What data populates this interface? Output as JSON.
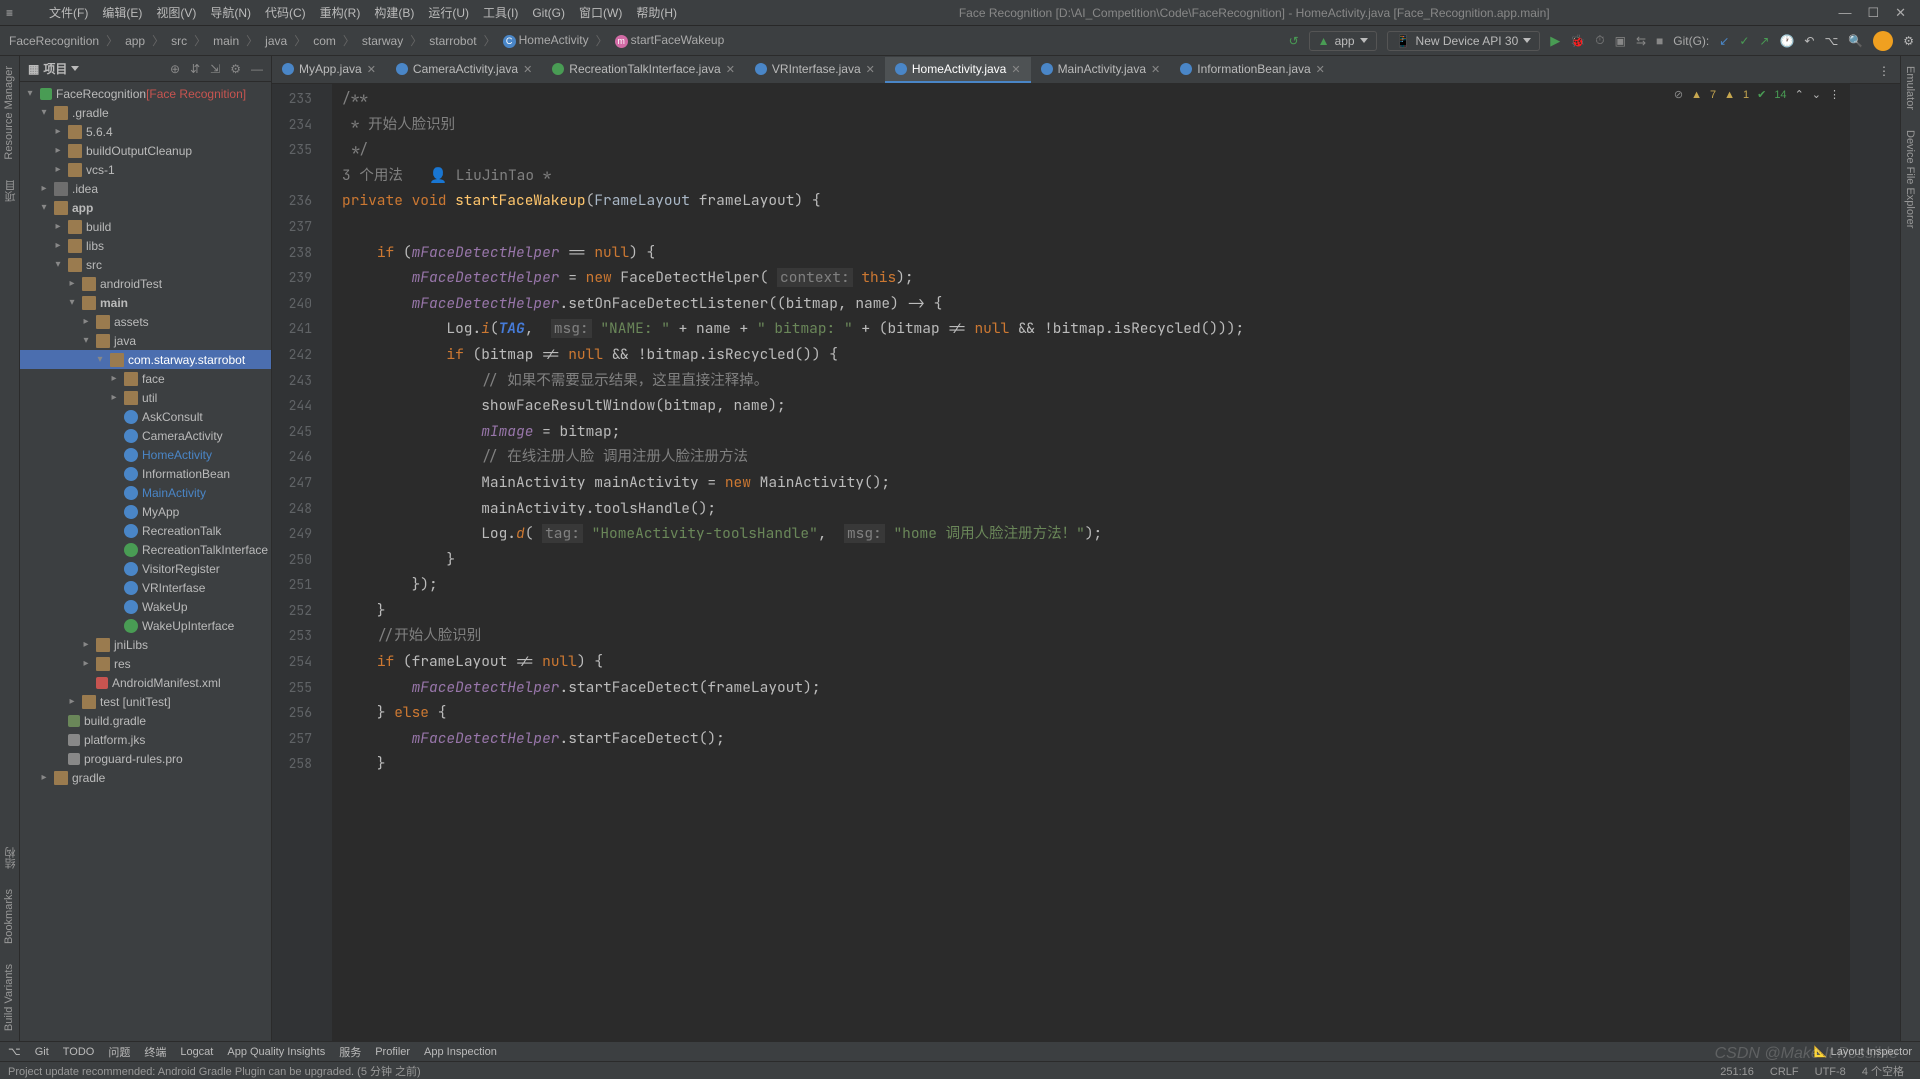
{
  "title": "Face Recognition [D:\\AI_Competition\\Code\\FaceRecognition] - HomeActivity.java [Face_Recognition.app.main]",
  "menus": [
    "文件(F)",
    "编辑(E)",
    "视图(V)",
    "导航(N)",
    "代码(C)",
    "重构(R)",
    "构建(B)",
    "运行(U)",
    "工具(I)",
    "Git(G)",
    "窗口(W)",
    "帮助(H)"
  ],
  "breadcrumb": [
    "FaceRecognition",
    "app",
    "src",
    "main",
    "java",
    "com",
    "starway",
    "starrobot"
  ],
  "breadcrumb_class": "HomeActivity",
  "breadcrumb_method": "startFaceWakeup",
  "run_config": "app",
  "device": "New Device API 30",
  "git_label": "Git(G):",
  "project_label": "项目",
  "tree": [
    {
      "d": 0,
      "a": "open",
      "i": "project",
      "t": "FaceRecognition",
      "suffix": " [Face Recognition]"
    },
    {
      "d": 1,
      "a": "open",
      "i": "folder",
      "t": ".gradle"
    },
    {
      "d": 2,
      "a": "closed",
      "i": "folder",
      "t": "5.6.4"
    },
    {
      "d": 2,
      "a": "closed",
      "i": "folder",
      "t": "buildOutputCleanup"
    },
    {
      "d": 2,
      "a": "closed",
      "i": "folder",
      "t": "vcs-1"
    },
    {
      "d": 1,
      "a": "closed",
      "i": "folder-dark",
      "t": ".idea"
    },
    {
      "d": 1,
      "a": "open",
      "i": "folder",
      "t": "app",
      "hl": true
    },
    {
      "d": 2,
      "a": "closed",
      "i": "folder",
      "t": "build"
    },
    {
      "d": 2,
      "a": "closed",
      "i": "folder",
      "t": "libs"
    },
    {
      "d": 2,
      "a": "open",
      "i": "folder",
      "t": "src"
    },
    {
      "d": 3,
      "a": "closed",
      "i": "folder",
      "t": "androidTest"
    },
    {
      "d": 3,
      "a": "open",
      "i": "folder",
      "t": "main",
      "hl": true
    },
    {
      "d": 4,
      "a": "closed",
      "i": "folder",
      "t": "assets"
    },
    {
      "d": 4,
      "a": "open",
      "i": "folder",
      "t": "java"
    },
    {
      "d": 5,
      "a": "open",
      "i": "folder",
      "t": "com.starway.starrobot",
      "sel": true
    },
    {
      "d": 6,
      "a": "closed",
      "i": "folder",
      "t": "face"
    },
    {
      "d": 6,
      "a": "closed",
      "i": "folder",
      "t": "util"
    },
    {
      "d": 6,
      "a": "none",
      "i": "class",
      "t": "AskConsult"
    },
    {
      "d": 6,
      "a": "none",
      "i": "class",
      "t": "CameraActivity"
    },
    {
      "d": 6,
      "a": "none",
      "i": "class",
      "t": "HomeActivity",
      "active": true
    },
    {
      "d": 6,
      "a": "none",
      "i": "class",
      "t": "InformationBean"
    },
    {
      "d": 6,
      "a": "none",
      "i": "class",
      "t": "MainActivity",
      "active": true
    },
    {
      "d": 6,
      "a": "none",
      "i": "class",
      "t": "MyApp"
    },
    {
      "d": 6,
      "a": "none",
      "i": "class",
      "t": "RecreationTalk"
    },
    {
      "d": 6,
      "a": "none",
      "i": "class-i",
      "t": "RecreationTalkInterface"
    },
    {
      "d": 6,
      "a": "none",
      "i": "class",
      "t": "VisitorRegister"
    },
    {
      "d": 6,
      "a": "none",
      "i": "class",
      "t": "VRInterfase"
    },
    {
      "d": 6,
      "a": "none",
      "i": "class",
      "t": "WakeUp"
    },
    {
      "d": 6,
      "a": "none",
      "i": "class-i",
      "t": "WakeUpInterface"
    },
    {
      "d": 4,
      "a": "closed",
      "i": "folder",
      "t": "jniLibs"
    },
    {
      "d": 4,
      "a": "closed",
      "i": "folder",
      "t": "res"
    },
    {
      "d": 4,
      "a": "none",
      "i": "xml",
      "t": "AndroidManifest.xml"
    },
    {
      "d": 3,
      "a": "closed",
      "i": "folder",
      "t": "test [unitTest]"
    },
    {
      "d": 2,
      "a": "none",
      "i": "gradle",
      "t": "build.gradle"
    },
    {
      "d": 2,
      "a": "none",
      "i": "jks",
      "t": "platform.jks"
    },
    {
      "d": 2,
      "a": "none",
      "i": "jks",
      "t": "proguard-rules.pro"
    },
    {
      "d": 1,
      "a": "closed",
      "i": "folder",
      "t": "gradle"
    }
  ],
  "tabs": [
    {
      "icon": "class",
      "label": "MyApp.java"
    },
    {
      "icon": "class",
      "label": "CameraActivity.java"
    },
    {
      "icon": "class-i",
      "label": "RecreationTalkInterface.java"
    },
    {
      "icon": "class",
      "label": "VRInterfase.java"
    },
    {
      "icon": "class",
      "label": "HomeActivity.java",
      "active": true
    },
    {
      "icon": "class",
      "label": "MainActivity.java"
    },
    {
      "icon": "class",
      "label": "InformationBean.java"
    }
  ],
  "inspect": {
    "warn1": "7",
    "warn2": "1",
    "chk": "14"
  },
  "usages": "3 个用法",
  "author": "LiuJinTao *",
  "lines": [
    233,
    234,
    235,
    null,
    236,
    237,
    238,
    239,
    240,
    241,
    242,
    243,
    244,
    245,
    246,
    247,
    248,
    249,
    250,
    251,
    252,
    253,
    254,
    255,
    256,
    257,
    258
  ],
  "code": "<span class='c-cmt'>/**</span>\n<span class='c-cmt'> * 开始人脸识别</span>\n<span class='c-cmt'> */</span>\n<span class='c-author'>3 个用法   👤 LiuJinTao *</span>\n<span class='c-key'>private void</span> <span class='c-method'>startFaceWakeup</span>(<span class='c-type'>FrameLayout</span> frameLayout) {\n\n    <span class='c-key'>if</span> (<span class='c-field'>mFaceDetectHelper</span> == <span class='c-null'>null</span>) {\n        <span class='c-field'>mFaceDetectHelper</span> = <span class='c-key'>new</span> FaceDetectHelper( <span class='c-ann'>context:</span> <span class='c-key'>this</span>);\n        <span class='c-field'>mFaceDetectHelper</span>.setOnFaceDetectListener((bitmap, name) -> {\n            Log.<span class='c-static'>i</span>(<span class='c-param'>TAG</span>,  <span class='c-ann'>msg:</span> <span class='c-str'>\"NAME: \"</span> + name + <span class='c-str'>\" bitmap: \"</span> + (bitmap != <span class='c-null'>null</span> && !bitmap.isRecycled()));\n            <span class='c-key'>if</span> (bitmap != <span class='c-null'>null</span> && !bitmap.isRecycled()) {\n                <span class='c-cmt'>// 如果不需要显示结果，这里直接注释掉。</span>\n                showFaceResultWindow(bitmap, name);\n                <span class='c-field'>mImage</span> = bitmap;\n                <span class='c-cmt'>// 在线注册人脸 调用注册人脸注册方法</span>\n                MainActivity mainActivity = <span class='c-key'>new</span> MainActivity();\n                mainActivity.toolsHandle();\n                Log.<span class='c-static'>d</span>( <span class='c-ann'>tag:</span> <span class='c-str'>\"HomeActivity-toolsHandle\"</span>,  <span class='c-ann'>msg:</span> <span class='c-str'>\"home 调用人脸注册方法！\"</span>);\n            }\n        });\n    }\n    <span class='c-cmt'>//开始人脸识别</span>\n    <span class='c-key'>if</span> (frameLayout != <span class='c-null'>null</span>) {\n        <span class='c-field'>mFaceDetectHelper</span>.startFaceDetect(frameLayout);\n    } <span class='c-key'>else</span> {\n        <span class='c-field'>mFaceDetectHelper</span>.startFaceDetect();\n    }",
  "left_vtabs_top": [
    "Resource Manager",
    "项目"
  ],
  "left_vtabs_bottom": [
    "结构",
    "Bookmarks",
    "Build Variants"
  ],
  "right_vtabs": [
    "Emulator",
    "Device File Explorer"
  ],
  "bottom_tools": [
    "Git",
    "TODO",
    "问题",
    "终端",
    "Logcat",
    "App Quality Insights",
    "服务",
    "Profiler",
    "App Inspection"
  ],
  "bottom_right": "Layout Inspector",
  "status_msg": "Project update recommended: Android Gradle Plugin can be upgraded. (5 分钟 之前)",
  "status_items": [
    "251:16",
    "CRLF",
    "UTF-8",
    "4 个空格"
  ],
  "watermark": "CSDN @Make It Possible"
}
